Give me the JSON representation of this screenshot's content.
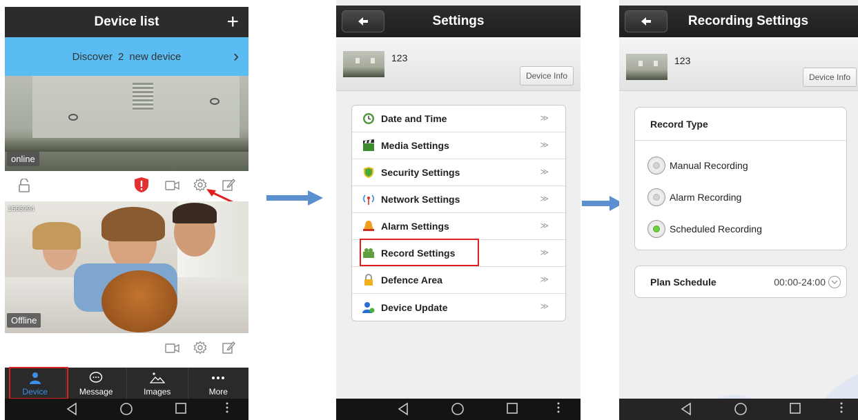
{
  "phone1": {
    "title": "Device list",
    "add_label": "+",
    "discover": {
      "prefix": "Discover",
      "count": "2",
      "suffix": "new device"
    },
    "camera1": {
      "status": "online"
    },
    "camera2": {
      "id": "1565994",
      "status": "Offline"
    },
    "tabs": [
      {
        "label": "Device",
        "icon": "person-icon",
        "active": true
      },
      {
        "label": "Message",
        "icon": "message-icon",
        "active": false
      },
      {
        "label": "Images",
        "icon": "images-icon",
        "active": false
      },
      {
        "label": "More",
        "icon": "more-icon",
        "active": false
      }
    ]
  },
  "phone2": {
    "title": "Settings",
    "device_name": "123",
    "device_info_label": "Device Info",
    "chevron": "≫",
    "menu": [
      {
        "label": "Date and Time",
        "icon": "clock-icon"
      },
      {
        "label": "Media Settings",
        "icon": "clapperboard-icon"
      },
      {
        "label": "Security Settings",
        "icon": "shield-icon"
      },
      {
        "label": "Network Settings",
        "icon": "antenna-icon"
      },
      {
        "label": "Alarm Settings",
        "icon": "bell-icon"
      },
      {
        "label": "Record Settings",
        "icon": "recorder-icon"
      },
      {
        "label": "Defence Area",
        "icon": "lock-icon"
      },
      {
        "label": "Device Update",
        "icon": "user-update-icon"
      }
    ]
  },
  "phone3": {
    "title": "Recording Settings",
    "device_name": "123",
    "device_info_label": "Device Info",
    "record_type_title": "Record Type",
    "options": [
      {
        "label": "Manual Recording",
        "selected": false
      },
      {
        "label": "Alarm Recording",
        "selected": false
      },
      {
        "label": "Scheduled Recording",
        "selected": true
      }
    ],
    "plan_label": "Plan Schedule",
    "plan_value": "00:00-24:00"
  },
  "colors": {
    "discover_bar": "#5bbcf2",
    "active_tab": "#3c8fe6",
    "highlight": "#e02020",
    "selected_radio": "#6fcf3d",
    "flow_arrow": "#5b8fd0"
  }
}
